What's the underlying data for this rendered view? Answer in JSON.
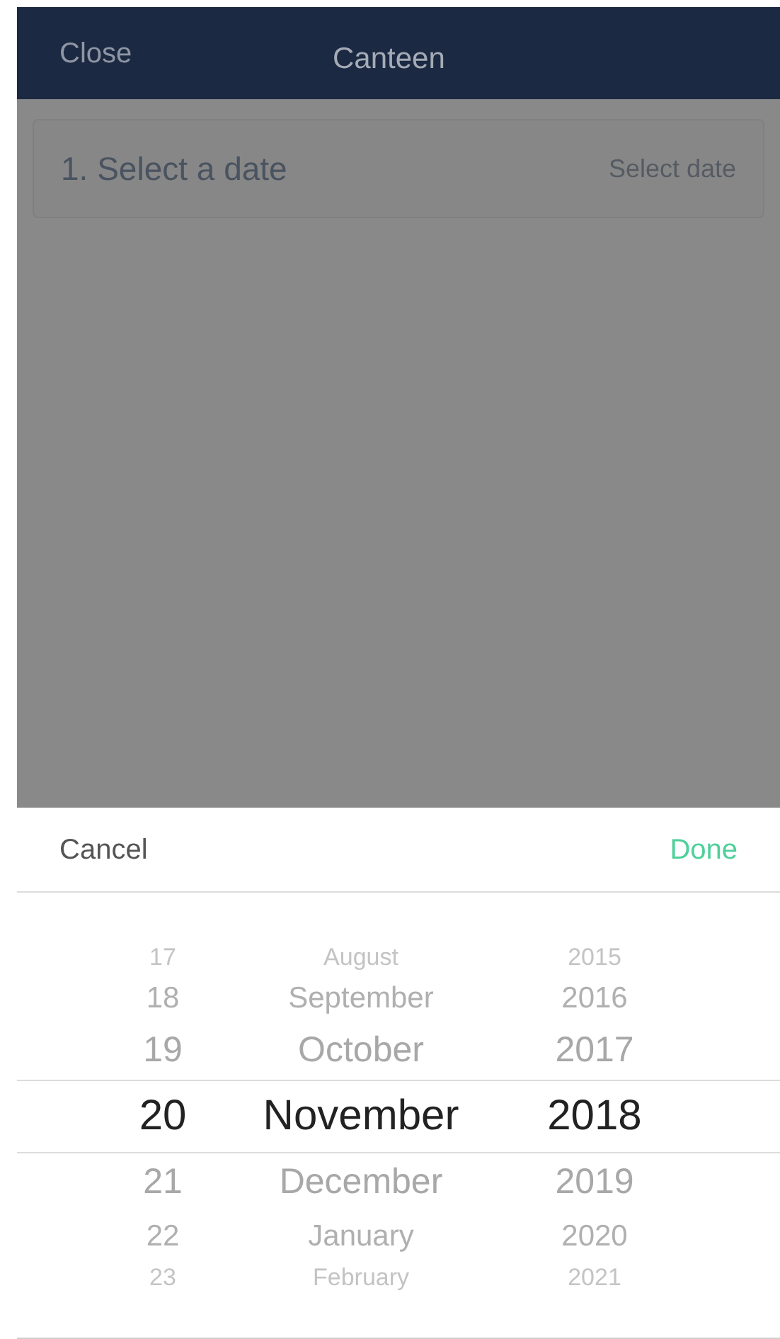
{
  "nav_bar": {
    "left_button": "Close",
    "title": "Canteen"
  },
  "step_card": {
    "label": "1. Select a date",
    "action": "Select date"
  },
  "picker_toolbar": {
    "cancel": "Cancel",
    "done": "Done"
  },
  "picker_rows": [
    {
      "day": "17",
      "month": "August",
      "year": "2015",
      "selected": false
    },
    {
      "day": "18",
      "month": "September",
      "year": "2016",
      "selected": false
    },
    {
      "day": "19",
      "month": "October",
      "year": "2017",
      "selected": false
    },
    {
      "day": "20",
      "month": "November",
      "year": "2018",
      "selected": true
    },
    {
      "day": "21",
      "month": "December",
      "year": "2019",
      "selected": false
    },
    {
      "day": "22",
      "month": "January",
      "year": "2020",
      "selected": false
    },
    {
      "day": "23",
      "month": "February",
      "year": "2021",
      "selected": false
    }
  ]
}
